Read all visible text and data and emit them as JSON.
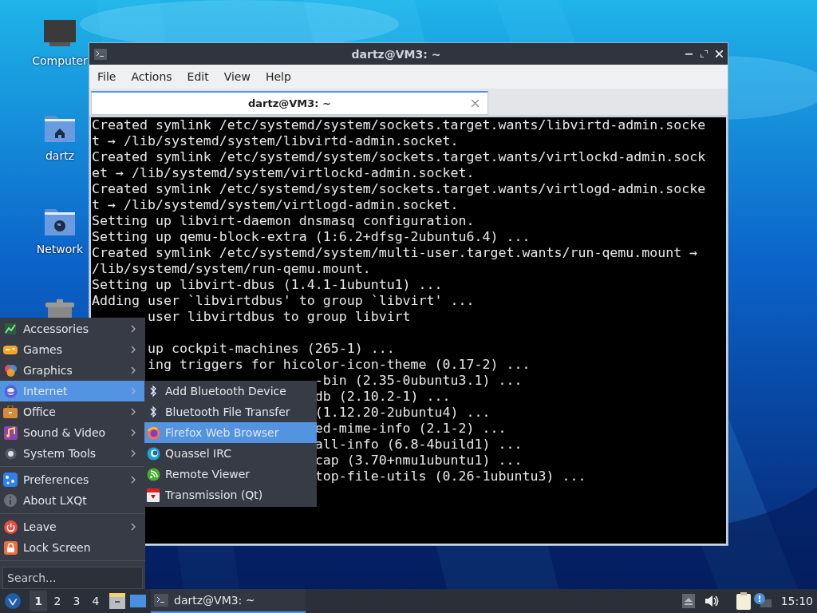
{
  "desktop_icons": [
    {
      "label": "Computer",
      "kind": "computer"
    },
    {
      "label": "dartz",
      "kind": "home"
    },
    {
      "label": "Network",
      "kind": "network"
    },
    {
      "kind": "trash"
    }
  ],
  "terminal": {
    "title": "dartz@VM3: ~",
    "menu": [
      "File",
      "Actions",
      "Edit",
      "View",
      "Help"
    ],
    "tabs": [
      {
        "label": "dartz@VM3: ~",
        "selected": true
      }
    ],
    "lines": [
      {
        "kind": "full",
        "text": "Created symlink /etc/systemd/system/sockets.target.wants/libvirtd-admin.socke"
      },
      {
        "kind": "full",
        "text": "t → /lib/systemd/system/libvirtd-admin.socket."
      },
      {
        "kind": "full",
        "text": "Created symlink /etc/systemd/system/sockets.target.wants/virtlockd-admin.sock"
      },
      {
        "kind": "full",
        "text": "et → /lib/systemd/system/virtlockd-admin.socket."
      },
      {
        "kind": "full",
        "text": "Created symlink /etc/systemd/system/sockets.target.wants/virtlogd-admin.socke"
      },
      {
        "kind": "full",
        "text": "t → /lib/systemd/system/virtlogd-admin.socket."
      },
      {
        "kind": "full",
        "text": "Setting up libvirt-daemon dnsmasq configuration."
      },
      {
        "kind": "full",
        "text": "Setting up qemu-block-extra (1:6.2+dfsg-2ubuntu6.4) ..."
      },
      {
        "kind": "full",
        "text": "Created symlink /etc/systemd/system/multi-user.target.wants/run-qemu.mount →"
      },
      {
        "kind": "full",
        "text": "/lib/systemd/system/run-qemu.mount."
      },
      {
        "kind": "full",
        "text": "Setting up libvirt-dbus (1.4.1-1ubuntu1) ..."
      },
      {
        "kind": "full",
        "text": "Adding user `libvirtdbus' to group `libvirt' ..."
      },
      {
        "kind": "behind-menu",
        "text": "user libvirtdbus to group libvirt"
      },
      {
        "kind": "blank"
      },
      {
        "kind": "behind-menu",
        "text": "up cockpit-machines (265-1) ..."
      },
      {
        "kind": "behind-menu",
        "text": "ing triggers for hicolor-icon-theme (0.17-2) ..."
      },
      {
        "kind": "behind-submenu",
        "text": "-bin (2.35-0ubuntu3.1) ..."
      },
      {
        "kind": "behind-submenu",
        "text": "db (2.10.2-1) ..."
      },
      {
        "kind": "behind-submenu",
        "text": "(1.12.20-2ubuntu4) ..."
      },
      {
        "kind": "behind-submenu",
        "text": "ed-mime-info (2.1-2) ..."
      },
      {
        "kind": "behind-submenu",
        "text": "all-info (6.8-4build1) ..."
      },
      {
        "kind": "behind-submenu",
        "text": "cap (3.70+nmu1ubuntu1) ..."
      },
      {
        "kind": "behind-submenu",
        "text": "top-file-utils (0.26-1ubuntu3) ..."
      }
    ]
  },
  "app_menu": {
    "groups": [
      [
        {
          "label": "Accessories",
          "kind": "accessories",
          "has_submenu": true,
          "selected": false
        },
        {
          "label": "Games",
          "kind": "games",
          "has_submenu": true,
          "selected": false
        },
        {
          "label": "Graphics",
          "kind": "graphics",
          "has_submenu": true,
          "selected": false
        },
        {
          "label": "Internet",
          "kind": "internet",
          "has_submenu": true,
          "selected": true
        },
        {
          "label": "Office",
          "kind": "office",
          "has_submenu": true,
          "selected": false
        },
        {
          "label": "Sound & Video",
          "kind": "sound-video",
          "has_submenu": true,
          "selected": false
        },
        {
          "label": "System Tools",
          "kind": "system-tools",
          "has_submenu": true,
          "selected": false
        }
      ],
      [
        {
          "label": "Preferences",
          "kind": "preferences",
          "has_submenu": true,
          "selected": false
        },
        {
          "label": "About LXQt",
          "kind": "about",
          "has_submenu": false,
          "selected": false
        }
      ],
      [
        {
          "label": "Leave",
          "kind": "leave",
          "has_submenu": true,
          "selected": false
        },
        {
          "label": "Lock Screen",
          "kind": "lock",
          "has_submenu": false,
          "selected": false
        }
      ]
    ],
    "search": {
      "placeholder": "Search..."
    }
  },
  "submenu": {
    "items": [
      {
        "label": "Add Bluetooth Device",
        "kind": "bluetooth",
        "selected": false
      },
      {
        "label": "Bluetooth File Transfer",
        "kind": "bluetooth",
        "selected": false
      },
      {
        "label": "Firefox Web Browser",
        "kind": "browser",
        "selected": true
      },
      {
        "label": "Quassel IRC",
        "kind": "chat",
        "selected": false
      },
      {
        "label": "Remote Viewer",
        "kind": "remote",
        "selected": false
      },
      {
        "label": "Transmission (Qt)",
        "kind": "transmission",
        "selected": false
      }
    ]
  },
  "taskbar": {
    "desktops": [
      {
        "label": "1",
        "selected": true
      },
      {
        "label": "2",
        "selected": false
      },
      {
        "label": "3",
        "selected": false
      },
      {
        "label": "4",
        "selected": false
      }
    ],
    "tasks": [
      {
        "label": "dartz@VM3: ~",
        "selected": true
      }
    ],
    "clock": "15:10"
  }
}
